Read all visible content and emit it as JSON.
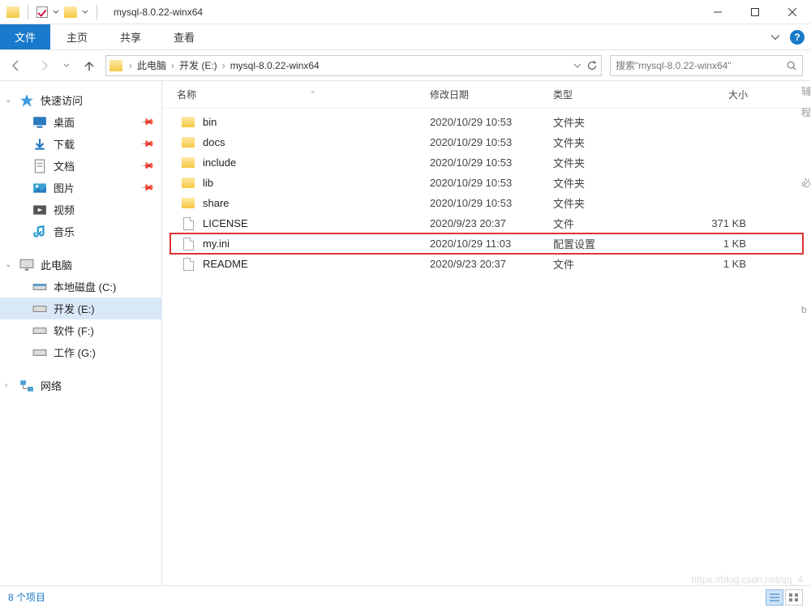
{
  "titlebar": {
    "title": "mysql-8.0.22-winx64"
  },
  "ribbon": {
    "file": "文件",
    "home": "主页",
    "share": "共享",
    "view": "查看"
  },
  "breadcrumb": {
    "root": "此电脑",
    "drive": "开发 (E:)",
    "folder": "mysql-8.0.22-winx64"
  },
  "search": {
    "placeholder": "搜索\"mysql-8.0.22-winx64\""
  },
  "columns": {
    "name": "名称",
    "date": "修改日期",
    "type": "类型",
    "size": "大小"
  },
  "sidebar": {
    "quick": "快速访问",
    "desktop": "桌面",
    "downloads": "下载",
    "documents": "文档",
    "pictures": "图片",
    "videos": "视频",
    "music": "音乐",
    "thispc": "此电脑",
    "drive_c": "本地磁盘 (C:)",
    "drive_e": "开发 (E:)",
    "drive_f": "软件 (F:)",
    "drive_g": "工作 (G:)",
    "network": "网络"
  },
  "files": [
    {
      "name": "bin",
      "date": "2020/10/29 10:53",
      "type": "文件夹",
      "size": "",
      "kind": "folder"
    },
    {
      "name": "docs",
      "date": "2020/10/29 10:53",
      "type": "文件夹",
      "size": "",
      "kind": "folder"
    },
    {
      "name": "include",
      "date": "2020/10/29 10:53",
      "type": "文件夹",
      "size": "",
      "kind": "folder"
    },
    {
      "name": "lib",
      "date": "2020/10/29 10:53",
      "type": "文件夹",
      "size": "",
      "kind": "folder"
    },
    {
      "name": "share",
      "date": "2020/10/29 10:53",
      "type": "文件夹",
      "size": "",
      "kind": "folder"
    },
    {
      "name": "LICENSE",
      "date": "2020/9/23 20:37",
      "type": "文件",
      "size": "371 KB",
      "kind": "file"
    },
    {
      "name": "my.ini",
      "date": "2020/10/29 11:03",
      "type": "配置设置",
      "size": "1 KB",
      "kind": "file",
      "highlight": true
    },
    {
      "name": "README",
      "date": "2020/9/23 20:37",
      "type": "文件",
      "size": "1 KB",
      "kind": "file"
    }
  ],
  "status": {
    "count_label": "8 个项目"
  },
  "side_hints": [
    "辅",
    "程",
    "必",
    "b"
  ],
  "watermark": "https://blog.csdn.net/qq_4"
}
